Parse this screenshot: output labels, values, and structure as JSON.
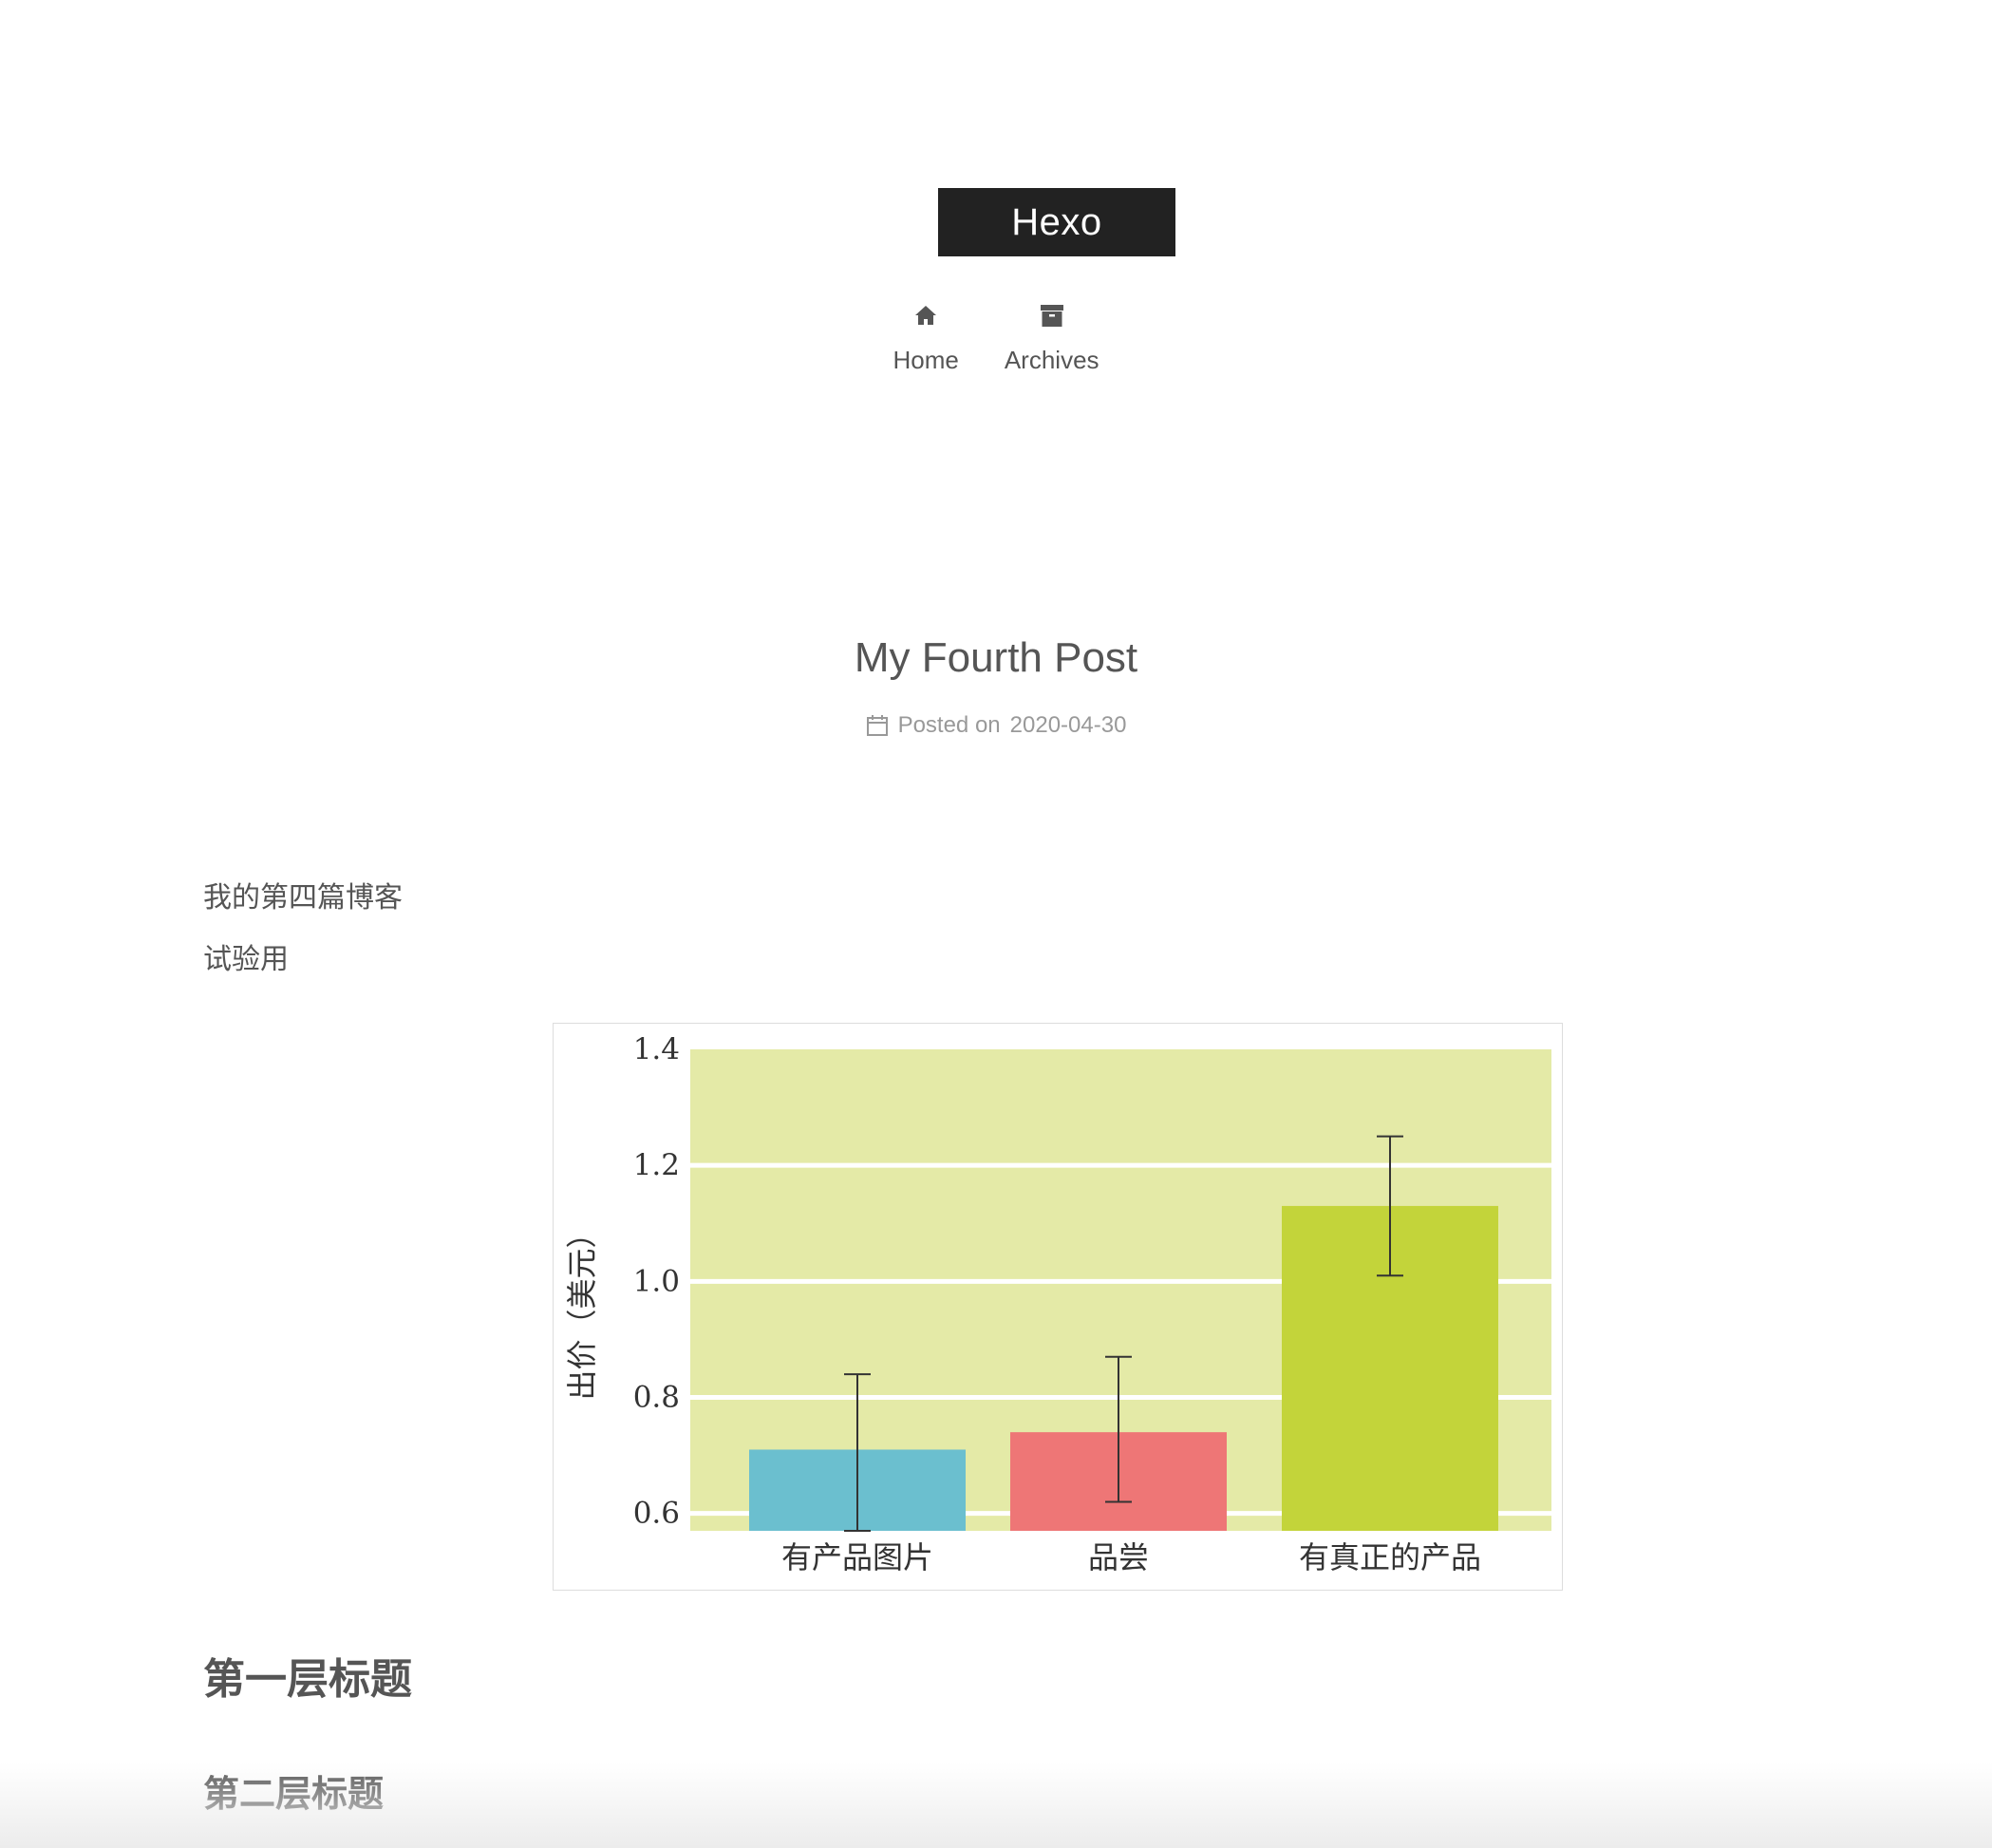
{
  "site": {
    "brand": "Hexo"
  },
  "menu": {
    "items": [
      {
        "label": "Home",
        "icon": "home-icon"
      },
      {
        "label": "Archives",
        "icon": "archive-icon"
      }
    ]
  },
  "post": {
    "title": "My Fourth Post",
    "meta_prefix": "Posted on",
    "date": "2020-04-30",
    "paragraphs": [
      "我的第四篇博客",
      "试验用"
    ],
    "heading_1": "第一层标题",
    "heading_2": "第二层标题"
  },
  "chart_data": {
    "type": "bar",
    "categories": [
      "有产品图片",
      "品尝",
      "有真正的产品"
    ],
    "values": [
      0.71,
      0.74,
      1.13
    ],
    "error_bars": [
      {
        "low": 0.57,
        "high": 0.84
      },
      {
        "low": 0.62,
        "high": 0.87
      },
      {
        "low": 1.01,
        "high": 1.25
      }
    ],
    "colors": [
      "#6bbfcf",
      "#ee7676",
      "#c3d43a"
    ],
    "background": "#e4eaa7",
    "ylabel": "出价（美元）",
    "xlabel": "",
    "ylim": [
      0.57,
      1.4
    ],
    "yticks": [
      "0.6",
      "0.8",
      "1.0",
      "1.2",
      "1.4"
    ],
    "grid": true
  }
}
